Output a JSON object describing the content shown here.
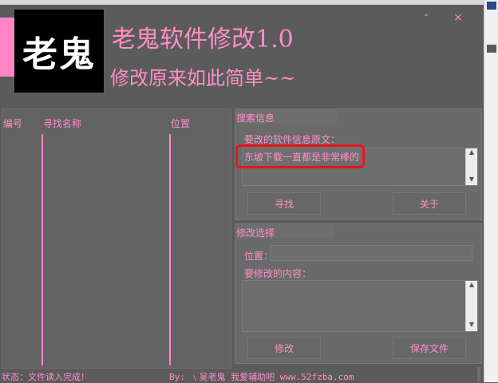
{
  "window": {
    "title": "老鬼软件修改1.0",
    "subtitle": "修改原来如此简单~~",
    "logo_text": "老鬼",
    "min_symbol": "-",
    "close_symbol": "×"
  },
  "list": {
    "columns": [
      "编号",
      "寻找名称",
      "位置"
    ]
  },
  "search": {
    "section_label": "搜索信息",
    "field_label": "要改的软件信息原文：",
    "field_value": "东坡下载一直都是非常棒的",
    "find_label": "寻找",
    "about_label": "关于"
  },
  "modify": {
    "section_label": "修改选择",
    "position_label": "位置：",
    "position_value": "",
    "content_label": "要修改的内容：",
    "content_value": "",
    "modify_label": "修改",
    "save_label": "保存文件"
  },
  "statusbar": {
    "status_text": "状态：文件读入完成！",
    "author_text": "By: ﹨吴老鬼  我爱辅助吧 www.52fzba.com"
  },
  "colors": {
    "accent_pink": "#ff86c7",
    "background": "#5b5b5b",
    "highlight_red": "#e8141e"
  }
}
